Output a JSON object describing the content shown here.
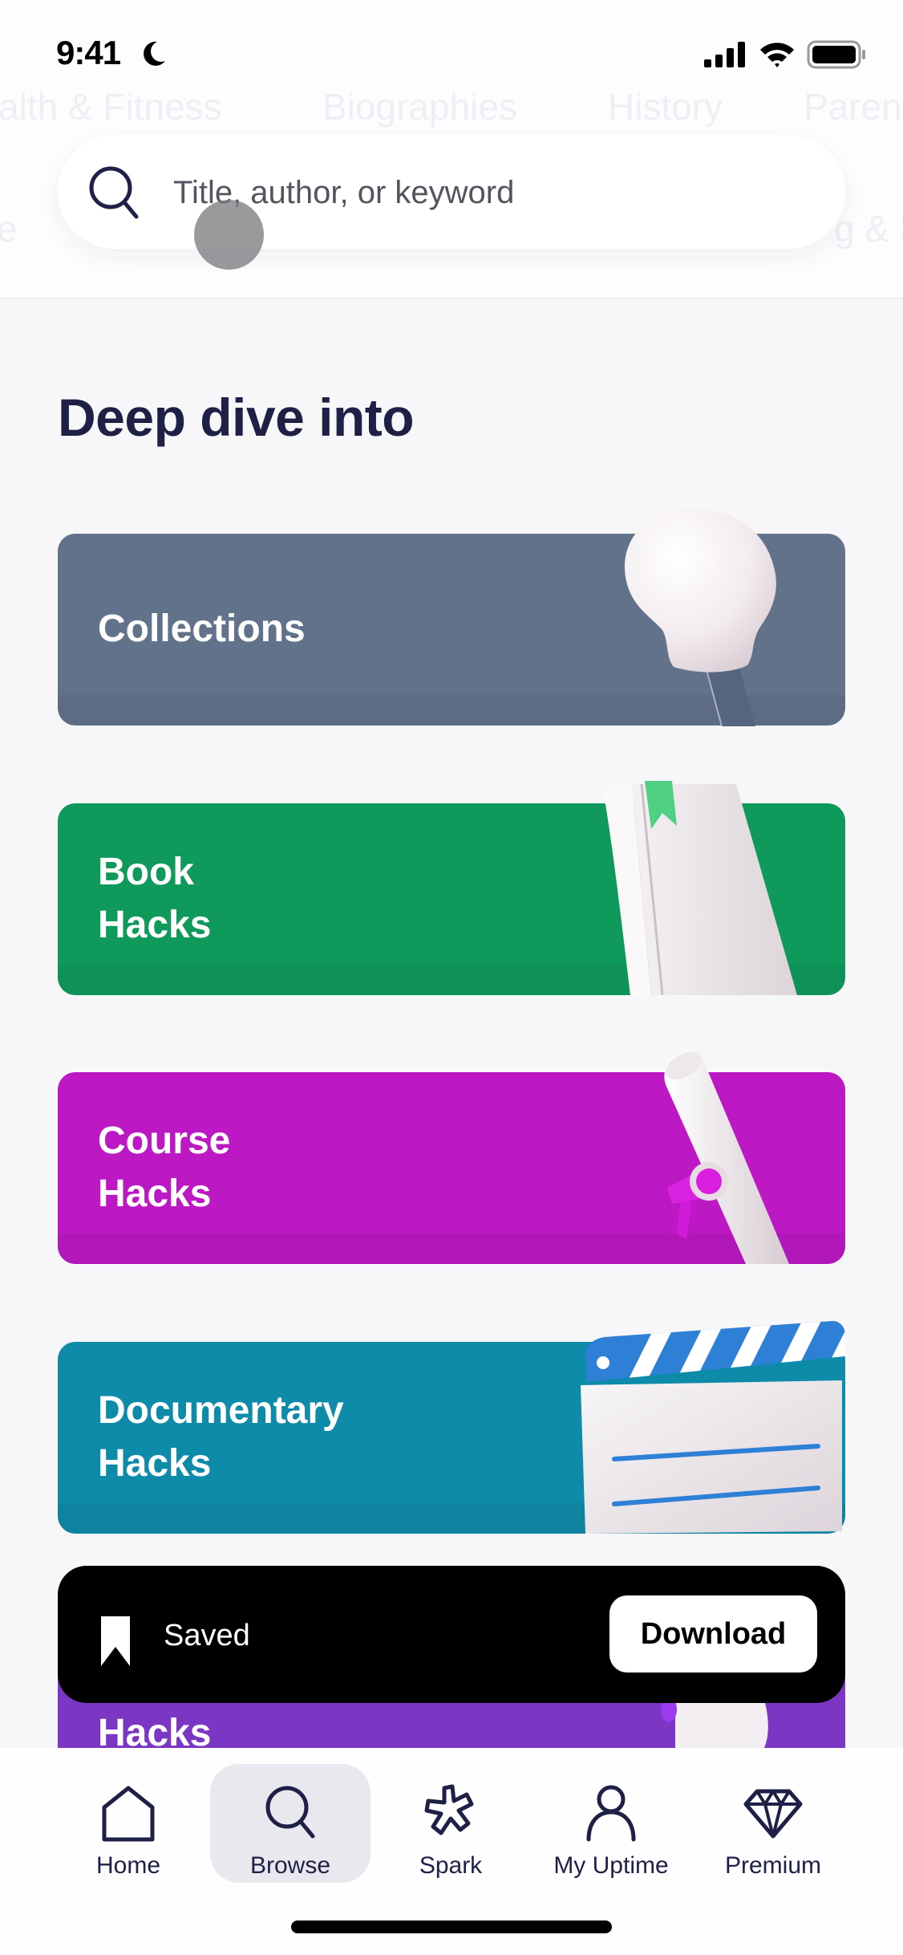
{
  "status_bar": {
    "time": "9:41",
    "focus_icon": "moon-icon",
    "icons": [
      "cellular-signal-icon",
      "wifi-icon",
      "battery-icon"
    ]
  },
  "category_row_faded": [
    "alth & Fitness",
    "Biographies",
    "History",
    "Paren"
  ],
  "category_row_faded_2": [
    "e",
    "g & S"
  ],
  "search": {
    "placeholder": "Title, author, or keyword",
    "icon": "search-icon"
  },
  "section": {
    "title": "Deep dive into"
  },
  "cards": [
    {
      "line1": "Collections",
      "line2": "",
      "color": "#62728A",
      "art": "lightbulb-illustration"
    },
    {
      "line1": "Book",
      "line2": "Hacks",
      "color": "#0F9A5C",
      "art": "book-illustration"
    },
    {
      "line1": "Course",
      "line2": "Hacks",
      "color": "#BC19C4",
      "art": "diploma-illustration"
    },
    {
      "line1": "Documentary",
      "line2": "Hacks",
      "color": "#0E8BA8",
      "art": "clapperboard-illustration"
    },
    {
      "line1": "",
      "line2": "Hacks",
      "color": "#7B36C4",
      "art": "partial-illustration"
    }
  ],
  "toast": {
    "icon": "bookmark-icon",
    "message": "Saved",
    "action_label": "Download"
  },
  "tabbar": {
    "active": "Browse",
    "tabs": [
      {
        "label": "Home",
        "icon": "home-icon"
      },
      {
        "label": "Browse",
        "icon": "search-icon"
      },
      {
        "label": "Spark",
        "icon": "spark-icon"
      },
      {
        "label": "My Uptime",
        "icon": "person-icon"
      },
      {
        "label": "Premium",
        "icon": "diamond-icon"
      }
    ]
  }
}
